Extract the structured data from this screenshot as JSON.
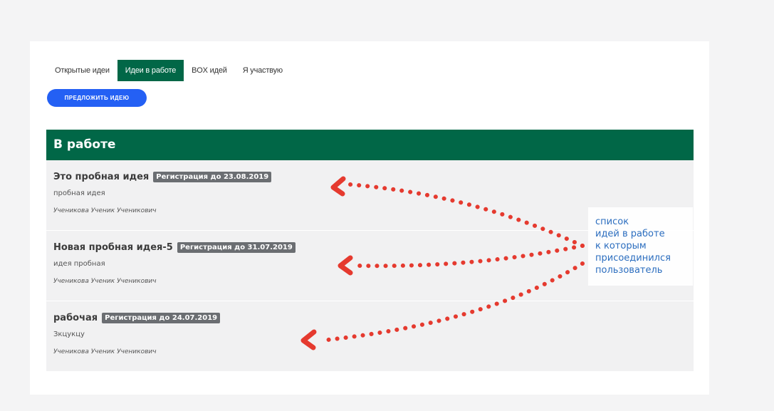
{
  "tabs": [
    {
      "label": "Открытые идеи",
      "active": false
    },
    {
      "label": "Идеи в работе",
      "active": true
    },
    {
      "label": "BOX идей",
      "active": false
    },
    {
      "label": "Я участвую",
      "active": false
    }
  ],
  "propose_button": {
    "label": "Предложить идею"
  },
  "panel": {
    "title": "В работе",
    "ideas": [
      {
        "title": "Это пробная идея",
        "badge": "Регистрация до 23.08.2019",
        "description": "пробная идея",
        "author": "Ученикова Ученик Ученикович"
      },
      {
        "title": "Новая пробная идея-5",
        "badge": "Регистрация до 31.07.2019",
        "description": "идея пробная",
        "author": "Ученикова Ученик Ученикович"
      },
      {
        "title": "рабочая",
        "badge": "Регистрация до 24.07.2019",
        "description": "Зкцукцу",
        "author": "Ученикова Ученик Ученикович"
      }
    ]
  },
  "annotation": {
    "lines": [
      "список",
      "идей в работе",
      "к которым",
      "присоединился",
      "пользователь"
    ]
  },
  "colors": {
    "primary_green": "#016747",
    "button_blue": "#2460f4",
    "badge_gray": "#6b6e72",
    "row_bg": "#f1f1f2",
    "annotation_text": "#2c6ebf",
    "arrow_red": "#e53a2f"
  }
}
